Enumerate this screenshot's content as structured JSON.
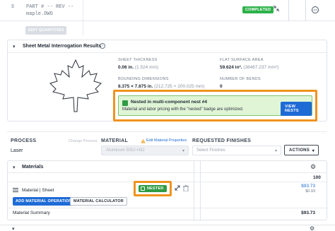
{
  "header": {
    "part_number_prefix": "$",
    "part_label": "PART # -- REV --",
    "file_name": "maple.DWG",
    "status_badge": "COMPLETED",
    "edit_quantities": "EDIT QUANTITIES"
  },
  "sheet_metal": {
    "title": "Sheet Metal Interrogation Results",
    "thickness_label": "SHEET THICKNESS",
    "thickness_value": "0.06 in.",
    "thickness_alt": "(1.524 mm)",
    "flat_area_label": "FLAT SURFACE AREA",
    "flat_area_value": "59.624 in².",
    "flat_area_alt": "(38467.237 mm²)",
    "bounding_label": "BOUNDING DIMENSIONS",
    "bounding_value": "8.375 × 7.875 in.",
    "bounding_alt": "(212.725 × 200.025 mm)",
    "bends_label": "NUMBER OF BENDS",
    "bends_value": "0",
    "nest_title": "Nested in multi-component nest #4",
    "nest_desc": "Material and labor pricing with the \"nested\" badge are optimized.",
    "view_nests": "VIEW NESTS"
  },
  "process_row": {
    "process_label": "PROCESS",
    "change_process": "Change Process",
    "process_value": "Laser",
    "material_label": "MATERIAL",
    "edit_material": "Edit Material Properties",
    "material_value": "Aluminum 5052-H32",
    "finishes_label": "REQUESTED FINISHES",
    "finishes_placeholder": "Select Finishes",
    "actions": "ACTIONS"
  },
  "materials": {
    "title": "Materials",
    "quantity_header": "100",
    "row_label": "Material | Sheet",
    "nested_badge": "NESTED",
    "price": "$93.73",
    "unit_price": "$0.93",
    "add_operation": "ADD MATERIAL OPERATION",
    "calculator": "MATERIAL CALCULATOR",
    "summary_label": "Material Summary",
    "summary_total": "$93.73"
  },
  "colors": {
    "accent": "#1e6bd6",
    "success": "#2db14a",
    "highlight": "#f0931e"
  }
}
